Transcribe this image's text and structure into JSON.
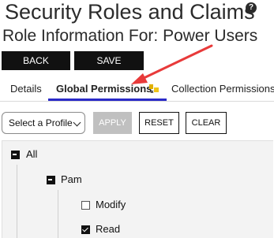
{
  "header": {
    "title": "Security Roles and Claims",
    "subtitle": "Role Information For: Power Users",
    "help_icon": "question-circle-icon"
  },
  "actions": {
    "back_label": "BACK",
    "save_label": "SAVE"
  },
  "tabs": [
    {
      "label": "Details",
      "active": false
    },
    {
      "label": "Global Permissions",
      "active": true,
      "icon": "permission-key-icon"
    },
    {
      "label": "Collection Permissions",
      "active": false
    }
  ],
  "toolbar": {
    "profile_select": {
      "selected": "Select a Profile"
    },
    "apply_label": "APPLY",
    "reset_label": "RESET",
    "clear_label": "CLEAR"
  },
  "tree": [
    {
      "label": "All",
      "state": "partial",
      "level": 0
    },
    {
      "label": "Pam",
      "state": "partial",
      "level": 1
    },
    {
      "label": "Modify",
      "state": "unchecked",
      "level": 2
    },
    {
      "label": "Read",
      "state": "checked",
      "level": 2
    }
  ],
  "colors": {
    "accent": "#2a2ac8",
    "dark_button": "#111111",
    "disabled_button": "#c0c0c0",
    "annotation_arrow": "#e83a3a"
  }
}
